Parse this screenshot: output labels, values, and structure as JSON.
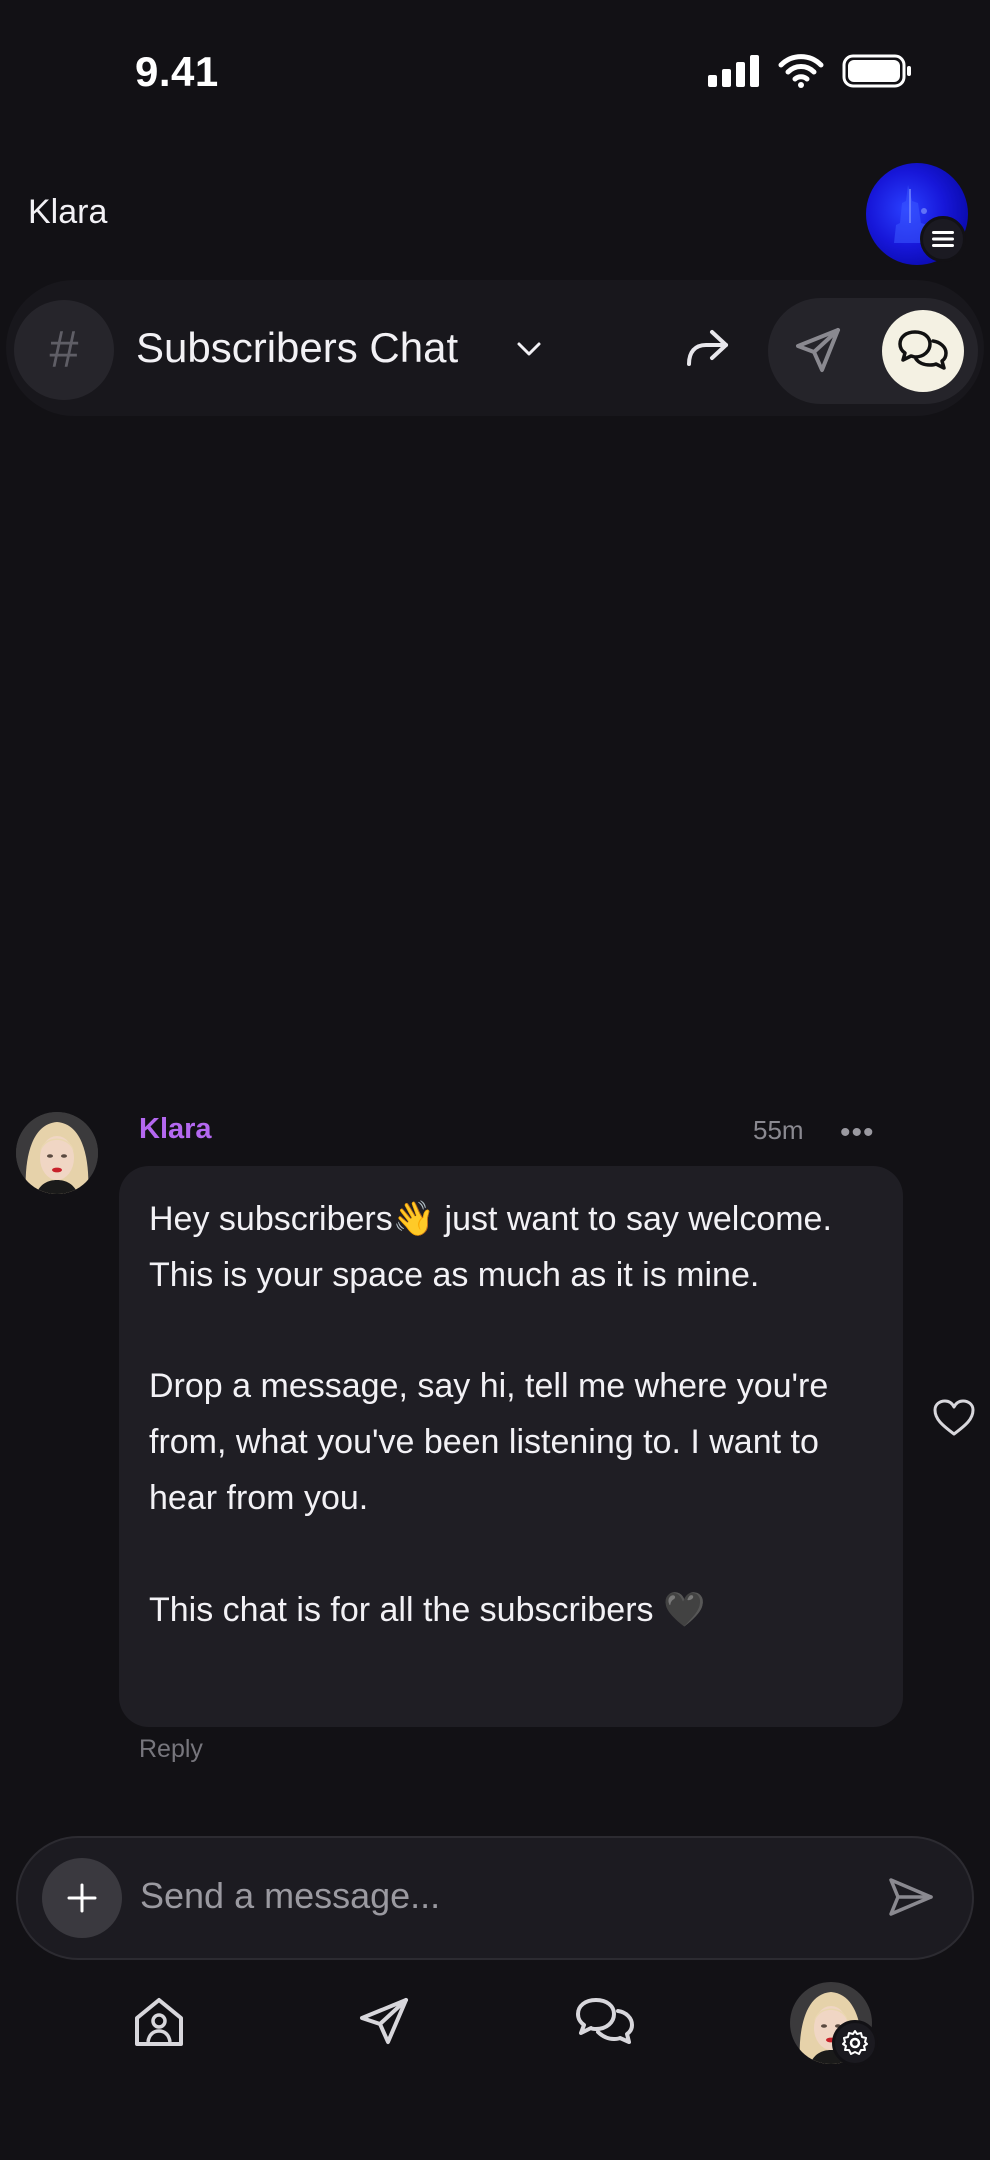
{
  "status_bar": {
    "time": "9.41"
  },
  "header": {
    "creator_name": "Klara"
  },
  "channel": {
    "title": "Subscribers Chat"
  },
  "message": {
    "author": "Klara",
    "time_ago": "55m",
    "text": "Hey subscribers👋 just want to say welcome. This is your space as much as it is mine.\n\nDrop a message, say hi, tell me where you're from, what you've been listening to. I want to hear from you.\n\nThis chat is for all the subscribers 🖤",
    "reply_label": "Reply"
  },
  "composer": {
    "placeholder": "Send a message..."
  },
  "icons": {
    "signal": "cellular-signal-icon",
    "wifi": "wifi-icon",
    "battery": "battery-icon",
    "menu": "menu-icon",
    "hash": "hash-icon",
    "chevron": "chevron-down-icon",
    "share": "share-icon",
    "send_mode": "paper-plane-icon",
    "chat_mode": "chat-bubbles-icon",
    "more": "more-horizontal-icon",
    "like": "heart-icon",
    "plus": "plus-icon",
    "send": "send-icon",
    "home": "home-icon",
    "gear": "gear-icon"
  },
  "colors": {
    "background": "#121115",
    "author_accent": "#b468f0",
    "active_mode": "#f4f1e3",
    "bubble": "#1f1e24"
  }
}
